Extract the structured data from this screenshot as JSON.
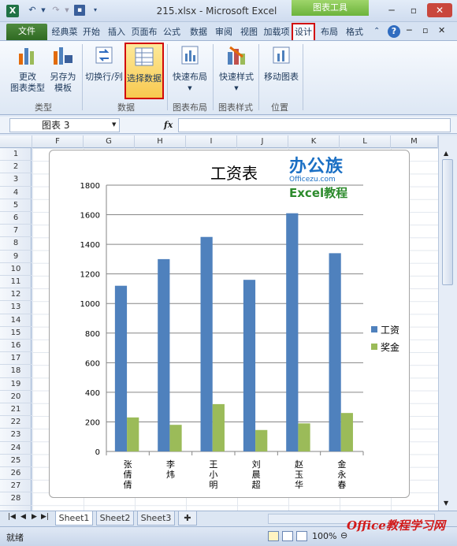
{
  "app": {
    "title": "215.xlsx  -  Microsoft Excel",
    "context_tab": "图表工具",
    "excel_icon": "X"
  },
  "tabs": [
    "文件",
    "经典菜",
    "开始",
    "插入",
    "页面布",
    "公式",
    "数据",
    "审阅",
    "视图",
    "加载项",
    "设计",
    "布局",
    "格式"
  ],
  "ribbon": {
    "buttons": [
      "更改\n图表类型",
      "另存为\n模板",
      "切换行/列",
      "选择数据",
      "快速布局",
      "快速样式",
      "移动图表"
    ],
    "groups": [
      "类型",
      "数据",
      "图表布局",
      "图表样式",
      "位置"
    ]
  },
  "formula": {
    "namebox": "图表 3",
    "fx": "fx"
  },
  "columns": [
    "F",
    "G",
    "H",
    "I",
    "J",
    "K",
    "L",
    "M"
  ],
  "rows": [
    "1",
    "2",
    "3",
    "4",
    "5",
    "6",
    "7",
    "8",
    "9",
    "10",
    "11",
    "12",
    "13",
    "14",
    "15",
    "16",
    "17",
    "18",
    "19",
    "20",
    "21",
    "22",
    "23",
    "24",
    "25",
    "26",
    "27",
    "28"
  ],
  "sheets": [
    "Sheet1",
    "Sheet2",
    "Sheet3"
  ],
  "status": {
    "ready": "就绪",
    "zoom": "100%"
  },
  "logo": {
    "brand": "办公族",
    "site": "Officezu.com",
    "subtitle": "Excel教程"
  },
  "watermark": "Office教程学习网",
  "colors": {
    "series1": "#4f81bd",
    "series2": "#9bbb59",
    "highlight": "#d20a0a"
  },
  "chart_data": {
    "type": "bar",
    "title": "工资表",
    "categories": [
      "张倩倩",
      "李炜",
      "王小明",
      "刘晨超",
      "赵玉华",
      "金永春"
    ],
    "series": [
      {
        "name": "工资",
        "values": [
          1120,
          1300,
          1450,
          1160,
          1610,
          1340
        ]
      },
      {
        "name": "奖金",
        "values": [
          230,
          180,
          320,
          145,
          190,
          260
        ]
      }
    ],
    "ylim": [
      0,
      1800
    ],
    "yticks": [
      "0",
      "200",
      "400",
      "600",
      "800",
      "1000",
      "1200",
      "1400",
      "1600",
      "1800"
    ],
    "grid": true,
    "legend": "right"
  }
}
